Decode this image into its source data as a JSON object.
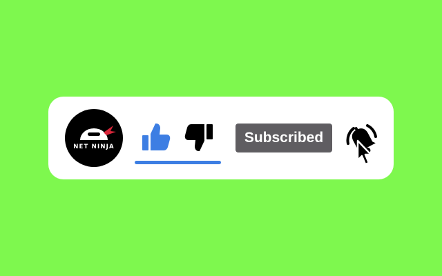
{
  "colors": {
    "background": "#7ef84e",
    "card": "#ffffff",
    "like_active": "#3d7ee3",
    "dislike": "#000000",
    "subscribed_button": "#5f5d61",
    "avatar_accent": "#d8263a"
  },
  "channel": {
    "name": "NET NINJA",
    "avatar_icon": "ninja-logo"
  },
  "like": {
    "icon": "thumbs-up-icon",
    "active": true
  },
  "dislike": {
    "icon": "thumbs-down-icon",
    "active": false
  },
  "subscribe": {
    "label": "Subscribed"
  },
  "notification": {
    "icon": "bell-ringing-icon",
    "cursor_icon": "cursor-pointer-icon"
  }
}
